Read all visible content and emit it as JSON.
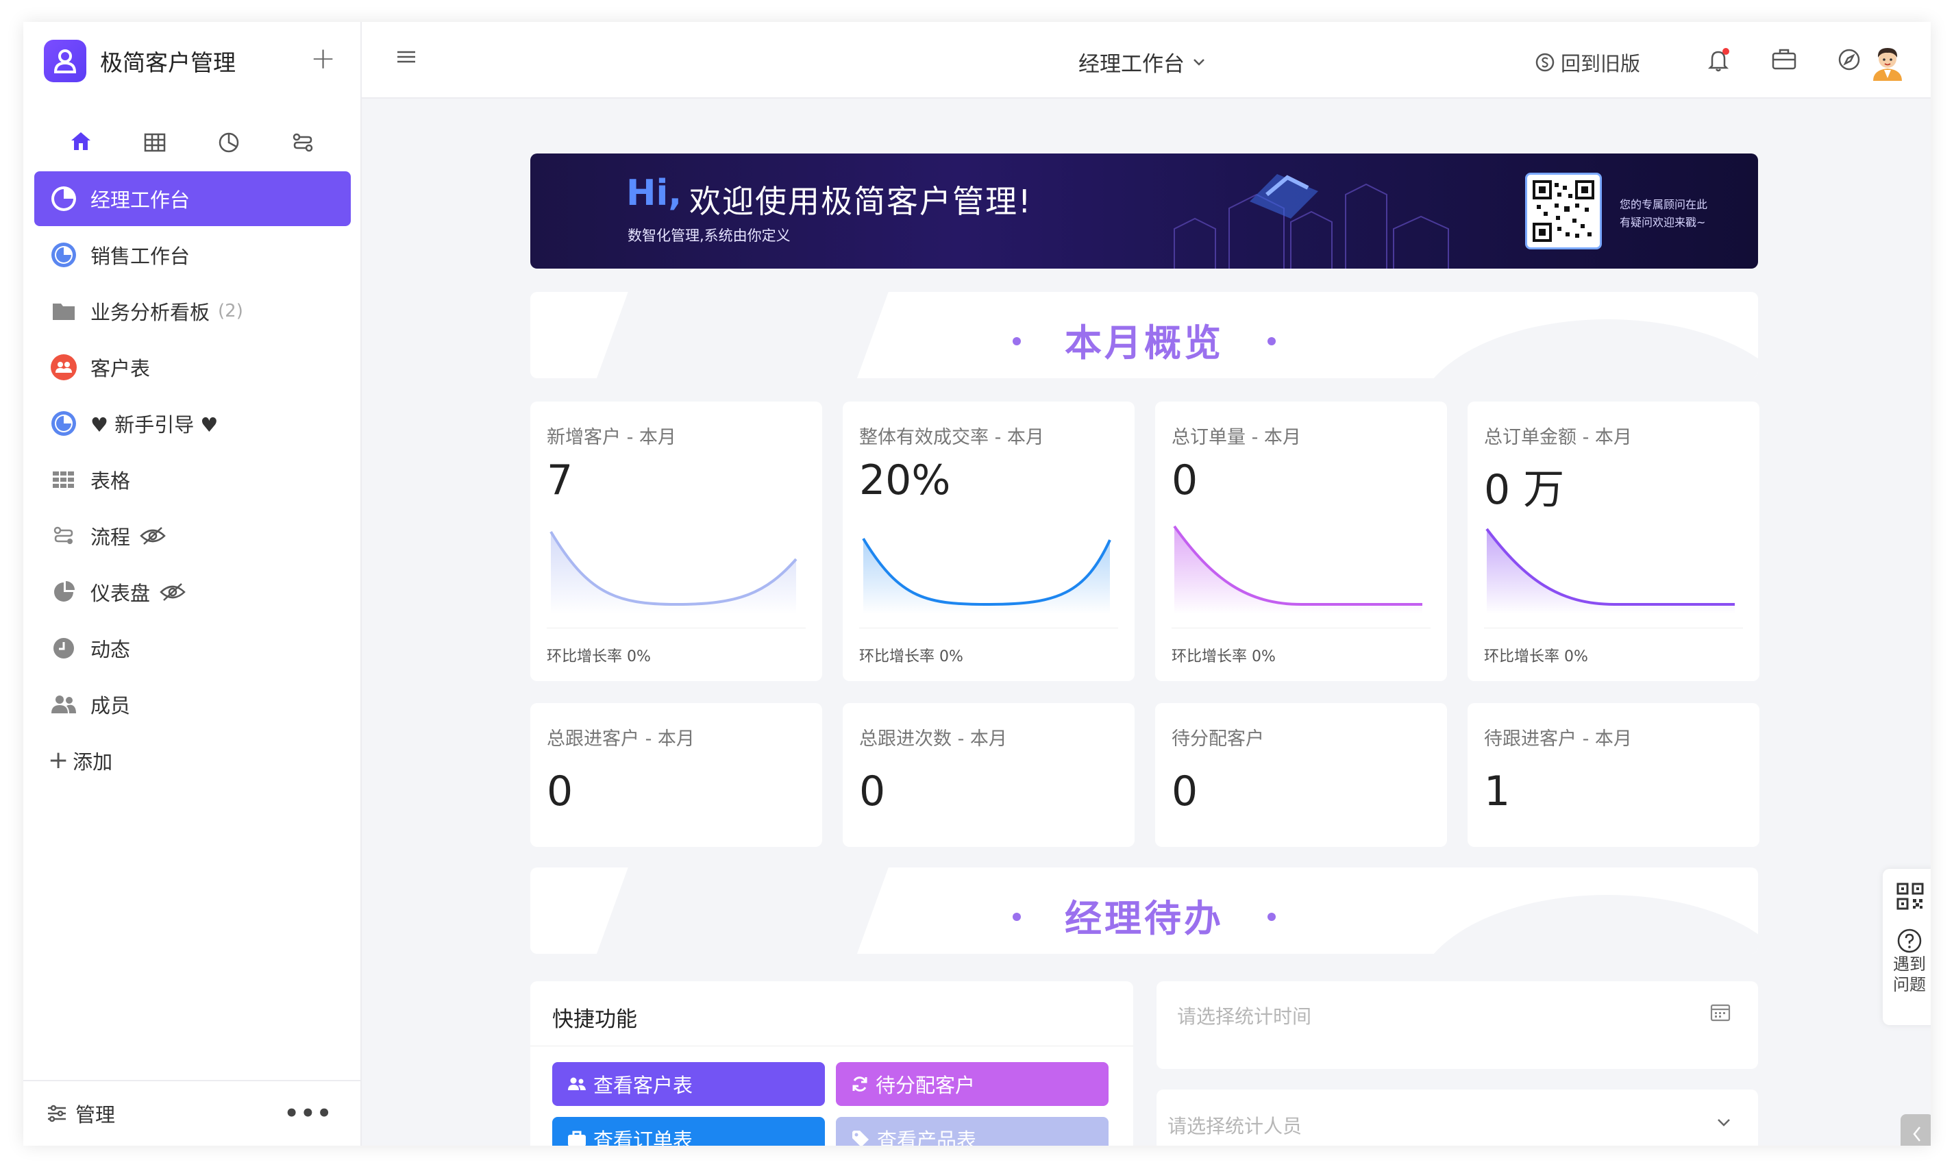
{
  "app": {
    "title": "极简客户管理"
  },
  "sidebar": {
    "items": [
      {
        "label": "经理工作台",
        "icon": "pie-chart-icon"
      },
      {
        "label": "销售工作台",
        "icon": "pie-chart-icon"
      },
      {
        "label": "业务分析看板",
        "count": "(2)",
        "icon": "folder-icon"
      },
      {
        "label": "客户表",
        "icon": "users-icon"
      },
      {
        "label": "♥ 新手引导 ♥",
        "icon": "pie-chart-icon"
      },
      {
        "label": "表格",
        "icon": "grid-icon"
      },
      {
        "label": "流程",
        "icon": "flow-icon"
      },
      {
        "label": "仪表盘",
        "icon": "pie-chart-icon"
      },
      {
        "label": "动态",
        "icon": "clock-icon"
      },
      {
        "label": "成员",
        "icon": "members-icon"
      },
      {
        "label": "添加",
        "icon": "plus-icon"
      }
    ],
    "footer": {
      "label": "管理",
      "more": "•••"
    }
  },
  "topbar": {
    "page_title": "经理工作台",
    "back_old": "回到旧版"
  },
  "banner": {
    "hi": "Hi,",
    "title": "欢迎使用极简客户管理!",
    "subtitle": "数智化管理,系统由你定义",
    "qr_line1": "您的专属顾问在此",
    "qr_line2": "有疑问欢迎来戳~"
  },
  "sections": {
    "overview": "本月概览",
    "todo": "经理待办"
  },
  "stats": [
    {
      "label": "新增客户 - 本月",
      "value": "7",
      "growth": "环比增长率 0%",
      "color": "#a9b7f2"
    },
    {
      "label": "整体有效成交率 - 本月",
      "value": "20%",
      "growth": "环比增长率 0%",
      "color": "#1d86f0"
    },
    {
      "label": "总订单量 - 本月",
      "value": "0",
      "growth": "环比增长率 0%",
      "color": "#c35ff0"
    },
    {
      "label": "总订单金额 - 本月",
      "value": "0 万",
      "growth": "环比增长率 0%",
      "color": "#8a4ef2"
    }
  ],
  "stats_small": [
    {
      "label": "总跟进客户 - 本月",
      "value": "0"
    },
    {
      "label": "总跟进次数 - 本月",
      "value": "0"
    },
    {
      "label": "待分配客户",
      "value": "0"
    },
    {
      "label": "待跟进客户 - 本月",
      "value": "1"
    }
  ],
  "quick": {
    "title": "快捷功能",
    "buttons": [
      {
        "label": "查看客户表",
        "color": "#7354f4"
      },
      {
        "label": "待分配客户",
        "color": "#c464ef"
      },
      {
        "label": "查看订单表",
        "color": "#1b86f2"
      },
      {
        "label": "查看产品表",
        "color": "#b7bff0"
      }
    ]
  },
  "filters": {
    "time_placeholder": "请选择统计时间",
    "person_placeholder": "请选择统计人员"
  },
  "float_panel": {
    "help": "遇到问题"
  }
}
